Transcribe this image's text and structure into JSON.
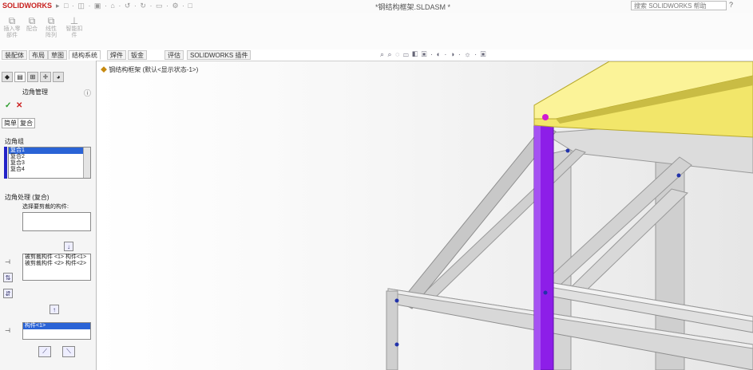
{
  "app": {
    "logo": "SOLIDWORKS",
    "doc_title": "*钢结构框架.SLDASM *",
    "search_placeholder": "搜索 SOLIDWORKS 帮助",
    "help": "?"
  },
  "ribbon": {
    "buttons": [
      {
        "label": "插入零部件",
        "icon": "insert-component-icon"
      },
      {
        "label": "配合",
        "icon": "mate-icon"
      },
      {
        "label": "线性阵列",
        "icon": "pattern-icon"
      },
      {
        "label": "智能扣件",
        "icon": "fastener-icon"
      }
    ]
  },
  "command_tabs": [
    "装配体",
    "布局",
    "草图",
    "结构系统",
    "焊件",
    "钣金",
    "评估",
    "SOLIDWORKS 插件"
  ],
  "active_tab_index": 3,
  "tree_root": "钢结构框架 (默认<显示状态-1>)",
  "property_manager": {
    "title": "边角管理",
    "help_icon": "question-icon",
    "ok": "✓",
    "cancel": "✕",
    "subtabs": [
      "简单",
      "复合"
    ],
    "corner_group": "边角组",
    "corner_items": [
      "复合1",
      "复合2",
      "复合3",
      "复合4"
    ],
    "treatment_group": "边角处理 (复合)",
    "treatment_hint": "选择要剪裁的构件:",
    "members_list": [
      "被剪裁构件 <1> 构件<1>",
      "被剪裁构件 <2> 构件<2>"
    ],
    "trim_body_item": "构件<1>"
  },
  "colors": {
    "selected_member": "#8d1ee8",
    "highlight_member": "#ffee66",
    "steel": "#d6d6d6"
  }
}
